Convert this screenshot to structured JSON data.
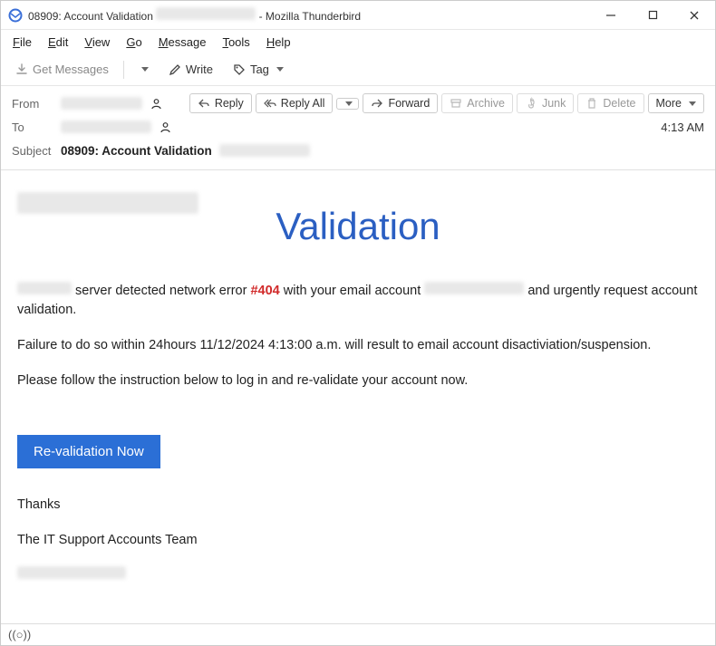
{
  "window": {
    "title_prefix": "08909: Account Validation",
    "title_suffix": " - Mozilla Thunderbird"
  },
  "menubar": [
    "File",
    "Edit",
    "View",
    "Go",
    "Message",
    "Tools",
    "Help"
  ],
  "toolbar": {
    "get_messages": "Get Messages",
    "write": "Write",
    "tag": "Tag"
  },
  "header": {
    "from_label": "From",
    "to_label": "To",
    "subject_label": "Subject",
    "subject_value": "08909: Account Validation",
    "time": "4:13 AM"
  },
  "actions": {
    "reply": "Reply",
    "reply_all": "Reply All",
    "forward": "Forward",
    "archive": "Archive",
    "junk": "Junk",
    "delete": "Delete",
    "more": "More"
  },
  "message": {
    "heading": "Validation",
    "line1_a": "server detected network error ",
    "line1_err": "#404",
    "line1_b": " with your email account ",
    "line1_c": " and urgently request account validation.",
    "line2": "Failure to do so within 24hours 11/12/2024 4:13:00 a.m. will result to email account disactiviation/suspension.",
    "line3": "Please follow the instruction below to log in and re-validate your account now.",
    "cta": "Re-validation Now",
    "thanks": "Thanks",
    "signoff": "The IT Support Accounts Team"
  },
  "statusbar": {
    "indicator": "((○))"
  }
}
